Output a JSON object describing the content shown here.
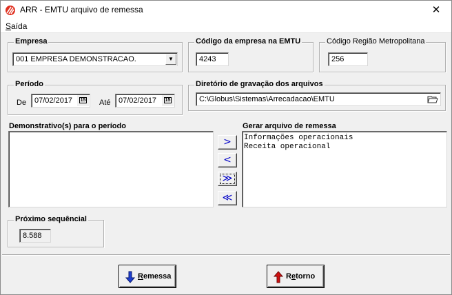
{
  "window": {
    "title": "ARR - EMTU arquivo de remessa",
    "close_symbol": "✕",
    "app_icon": "arr-logo-icon"
  },
  "menu": {
    "items": [
      {
        "label": "Saída",
        "accel_index": 0
      }
    ]
  },
  "empresa": {
    "legend": "Empresa",
    "selected": "001 EMPRESA DEMONSTRACAO."
  },
  "codigo_empresa": {
    "legend": "Código da empresa na EMTU",
    "value": "4243"
  },
  "codigo_regiao": {
    "legend": "Código Região Metropolitana",
    "value": "256"
  },
  "periodo": {
    "legend": "Período",
    "de_label": "De",
    "de_value": "07/02/2017",
    "ate_label": "Até",
    "ate_value": "07/02/2017",
    "calendar_icon_text": "15"
  },
  "diretorio": {
    "legend": "Diretório  de gravação dos arquivos",
    "value": "C:\\Globus\\Sistemas\\Arrecadacao\\EMTU"
  },
  "demonstrativos": {
    "label": "Demonstrativo(s)  para o período",
    "items": []
  },
  "gerar": {
    "label": "Gerar  arquivo de remessa",
    "items": [
      "Informações operacionais",
      "Receita operacional"
    ]
  },
  "transfer_buttons": {
    "move_right": ">",
    "move_left": "<",
    "move_all_right": "≫",
    "move_all_left": "≪"
  },
  "proximo_sequencial": {
    "legend": "Próximo sequêncial",
    "value": "8.588"
  },
  "buttons": {
    "remessa": {
      "label": "Remessa",
      "accel": "R"
    },
    "retorno": {
      "label": "Retorno",
      "accel": "R"
    }
  },
  "colors": {
    "arrow_blue": "#0000c8",
    "remessa_arrow": "#1e3fd0",
    "retorno_arrow": "#d01010",
    "logo_red": "#e03020"
  }
}
